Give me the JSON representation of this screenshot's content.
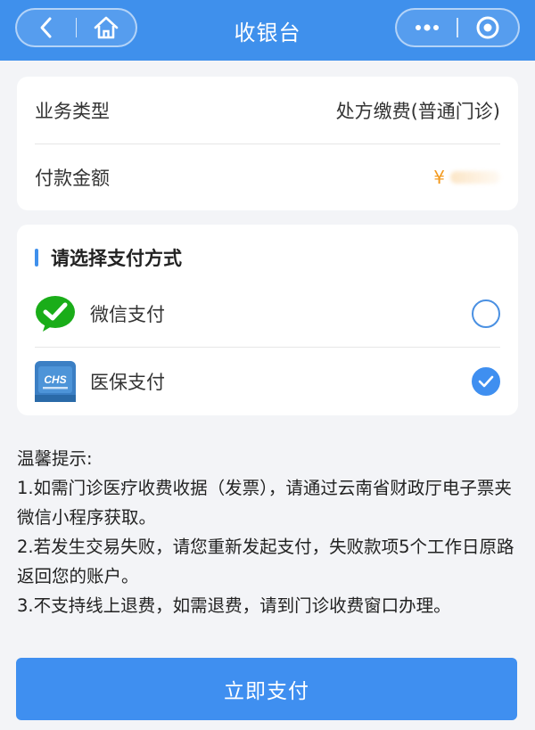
{
  "nav": {
    "title": "收银台",
    "back_icon": "chevron-left-icon",
    "home_icon": "home-icon",
    "more_icon": "more-dots-icon",
    "close_icon": "target-close-icon"
  },
  "info": {
    "business_type_label": "业务类型",
    "business_type_value": "处方缴费(普通门诊)",
    "amount_label": "付款金额",
    "amount_currency": "¥"
  },
  "payment": {
    "heading": "请选择支付方式",
    "options": [
      {
        "label": "微信支付",
        "icon": "wechat-pay-icon",
        "selected": false
      },
      {
        "label": "医保支付",
        "icon": "chs-medical-insurance-icon",
        "icon_text": "CHS",
        "selected": true
      }
    ]
  },
  "tips": {
    "title": "温馨提示:",
    "items": [
      "1.如需门诊医疗收费收据（发票），请通过云南省财政厅电子票夹微信小程序获取。",
      "2.若发生交易失败，请您重新发起支付，失败款项5个工作日原路返回您的账户。",
      "3.不支持线上退费，如需退费，请到门诊收费窗口办理。"
    ]
  },
  "submit_label": "立即支付",
  "colors": {
    "primary": "#3f8ff0",
    "amount": "#f39a1f",
    "wechat_green": "#1aad19"
  }
}
